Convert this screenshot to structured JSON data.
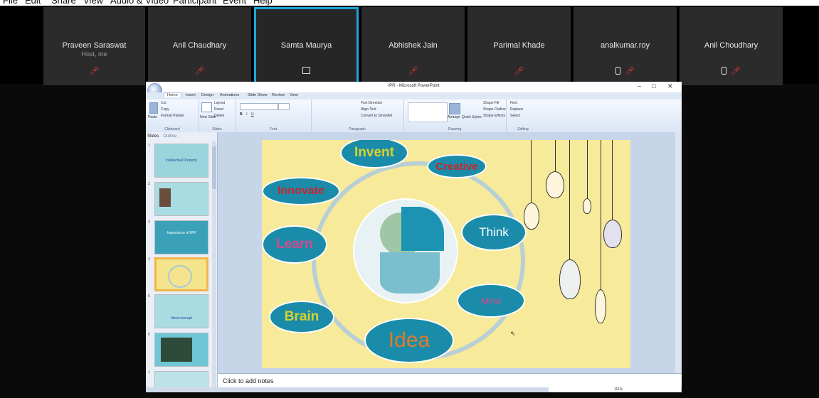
{
  "menu": [
    "File",
    "Edit",
    "Share",
    "View",
    "Audio & Video",
    "Participant",
    "Event",
    "Help"
  ],
  "participants": [
    {
      "name": "Praveen Saraswat",
      "sub": "Host, me",
      "icons": [
        "mic-muted"
      ]
    },
    {
      "name": "Anil Chaudhary",
      "sub": "",
      "icons": [
        "mic-muted"
      ]
    },
    {
      "name": "Samta Maurya",
      "sub": "",
      "icons": [
        "share"
      ],
      "active": true
    },
    {
      "name": "Abhishek Jain",
      "sub": "",
      "icons": [
        "mic-muted"
      ]
    },
    {
      "name": "Parimal Khade",
      "sub": "",
      "icons": [
        "mic-muted"
      ]
    },
    {
      "name": "analkumar.roy",
      "sub": "",
      "icons": [
        "phone",
        "mic-muted"
      ]
    },
    {
      "name": "Anil Choudhary",
      "sub": "",
      "icons": [
        "phone",
        "mic-muted"
      ]
    }
  ],
  "ppt": {
    "doc_title": "IPR - Microsoft PowerPoint",
    "tabs": [
      "Home",
      "Insert",
      "Design",
      "Animations",
      "Slide Show",
      "Review",
      "View"
    ],
    "groups": {
      "clipboard": {
        "label": "Clipboard",
        "items": [
          "Cut",
          "Copy",
          "Paste",
          "Format Painter"
        ]
      },
      "slides": {
        "label": "Slides",
        "items": [
          "New Slide",
          "Layout",
          "Reset",
          "Delete"
        ]
      },
      "font": {
        "label": "Font"
      },
      "paragraph": {
        "label": "Paragraph",
        "items": [
          "Text Direction",
          "Align Text",
          "Convert to SmartArt"
        ]
      },
      "drawing": {
        "label": "Drawing",
        "items": [
          "Arrange",
          "Quick Styles",
          "Shape Fill",
          "Shape Outline",
          "Shape Effects"
        ]
      },
      "editing": {
        "label": "Editing",
        "items": [
          "Find",
          "Replace",
          "Select"
        ]
      }
    },
    "panel_tabs": [
      "Slides",
      "Outline"
    ],
    "thumbnails": [
      {
        "num": "1",
        "title": "Intellectual Property"
      },
      {
        "num": "2",
        "title": ""
      },
      {
        "num": "3",
        "title": "Importance of IPR"
      },
      {
        "num": "4",
        "title": "",
        "selected": true
      },
      {
        "num": "5",
        "title": "Ideal concept"
      },
      {
        "num": "6",
        "title": ""
      },
      {
        "num": "7",
        "title": ""
      }
    ],
    "notes": "Click to add notes",
    "zoom": "111%"
  },
  "slide": {
    "bubbles": {
      "invent": "Invent",
      "creative": "Creative",
      "innovate": "Innovate",
      "think": "Think",
      "learn": "Learn",
      "mind": "Mind",
      "brain": "Brain",
      "idea": "Idea"
    },
    "colors": {
      "bubble": "#1a8ca9",
      "background": "#f7ea9a",
      "red": "#c8262d",
      "pink": "#d64a8c",
      "yellow": "#d9d22a",
      "orange": "#e07b2a"
    }
  }
}
